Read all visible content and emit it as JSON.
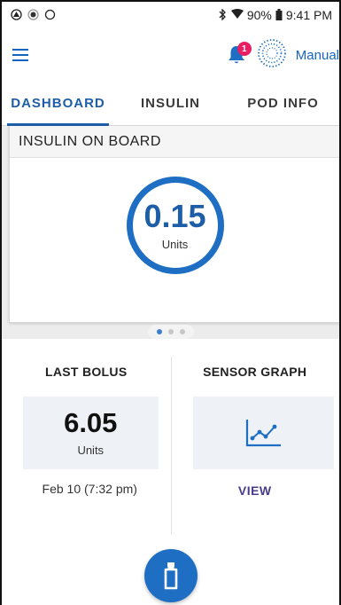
{
  "status_bar": {
    "left_icons": [
      "notification-icon",
      "dot-icon",
      "ring-icon"
    ],
    "bluetooth_icon": "bluetooth-icon",
    "wifi_icon": "wifi-icon",
    "battery_percent": "90%",
    "time": "9:41 PM"
  },
  "app_bar": {
    "notification_count": "1",
    "mode_label": "Manual"
  },
  "tabs": [
    {
      "label": "DASHBOARD",
      "active": true
    },
    {
      "label": "INSULIN",
      "active": false
    },
    {
      "label": "POD INFO",
      "active": false
    }
  ],
  "insulin_on_board": {
    "title": "INSULIN ON BOARD",
    "value": "0.15",
    "unit": "Units"
  },
  "pager": {
    "count": 3,
    "active_index": 0
  },
  "last_bolus": {
    "title": "LAST BOLUS",
    "value": "6.05",
    "unit": "Units",
    "date": "Feb 10 (7:32 pm)"
  },
  "sensor_graph": {
    "title": "SENSOR GRAPH",
    "view_label": "VIEW"
  },
  "colors": {
    "primary": "#1e6fc4",
    "accent_text": "#1e5ea8",
    "badge": "#e91e63",
    "view_link": "#4a3b8f"
  }
}
